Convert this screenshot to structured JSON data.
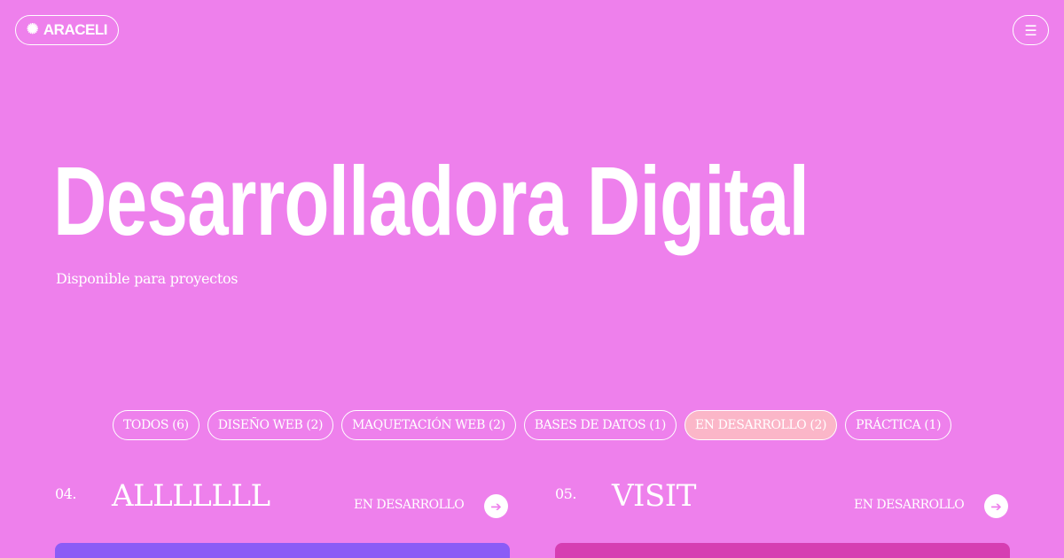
{
  "header": {
    "logo_icon": "sun-icon",
    "logo_text": "ARACELI",
    "menu_icon": "menu-icon"
  },
  "hero": {
    "title": "Desarrolladora Digital",
    "subtitle": "Disponible para proyectos"
  },
  "filters": [
    {
      "label": "TODOS (6)",
      "active": false
    },
    {
      "label": "DISEÑO WEB (2)",
      "active": false
    },
    {
      "label": "MAQUETACIÓN WEB (2)",
      "active": false
    },
    {
      "label": "BASES DE DATOS (1)",
      "active": false
    },
    {
      "label": "EN DESARROLLO (2)",
      "active": true
    },
    {
      "label": "PRÁCTICA (1)",
      "active": false
    }
  ],
  "projects": [
    {
      "number": "04.",
      "name": "ALLLLLLL",
      "status": "EN DESARROLLO",
      "arrow_icon": "arrow-right-icon",
      "thumb_color": "#8b5cf6"
    },
    {
      "number": "05.",
      "name": "VISIT",
      "status": "EN DESARROLLO",
      "arrow_icon": "arrow-right-icon",
      "thumb_color": "#d63eb2"
    }
  ],
  "colors": {
    "background": "#ee80ec",
    "text": "#ffffff",
    "active_filter": "#fbb6c8"
  }
}
